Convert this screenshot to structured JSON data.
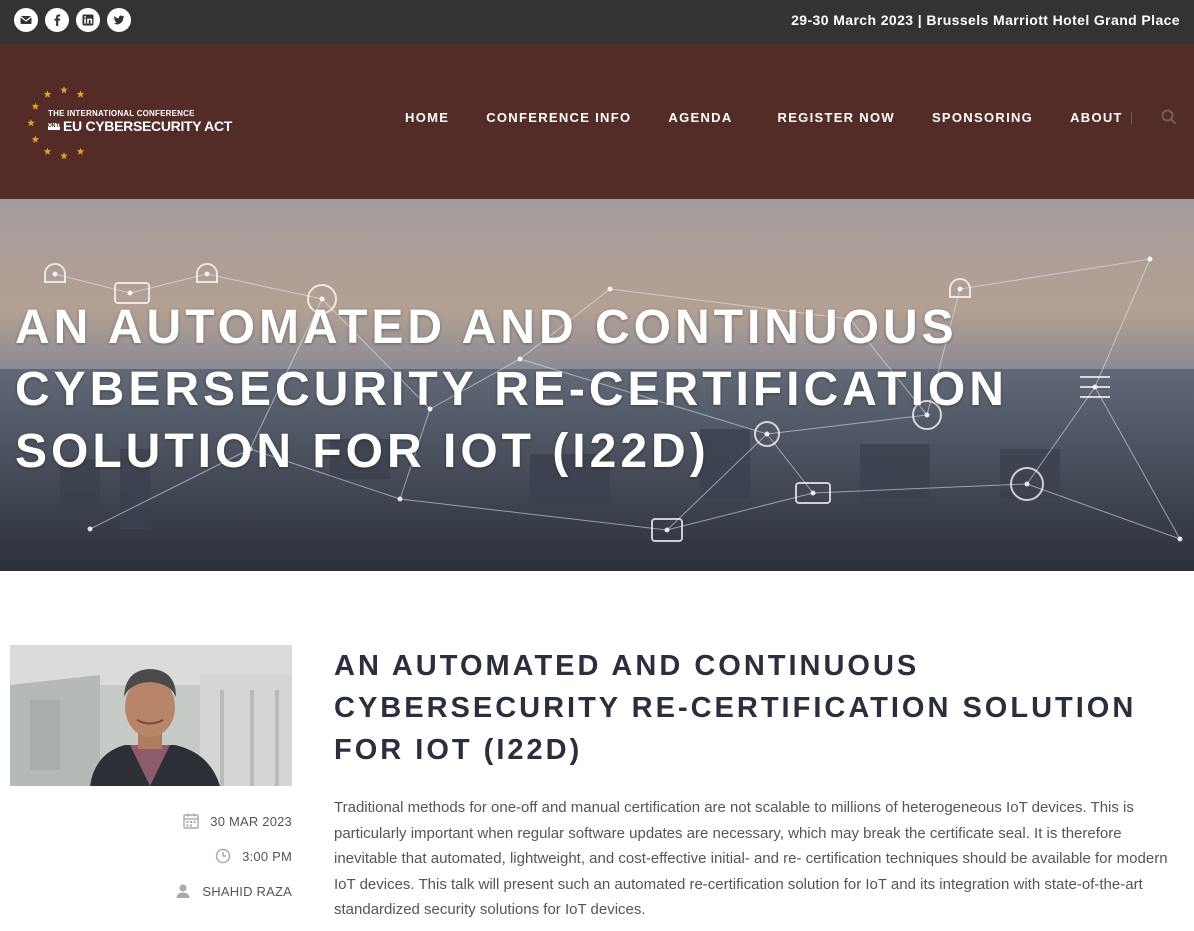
{
  "topbar": {
    "social": [
      {
        "name": "email-icon"
      },
      {
        "name": "facebook-icon"
      },
      {
        "name": "linkedin-icon"
      },
      {
        "name": "twitter-icon"
      }
    ],
    "event_info": "29-30 March 2023 | Brussels Marriott Hotel Grand Place"
  },
  "header": {
    "logo": {
      "line1": "THE INTERNATIONAL CONFERENCE",
      "small": "ON THE",
      "line2": "EU CYBERSECURITY ACT",
      "star_color": "#e2a12a"
    },
    "nav": [
      {
        "label": "HOME"
      },
      {
        "label": "CONFERENCE INFO"
      },
      {
        "label": "AGENDA"
      },
      {
        "label": "REGISTER NOW"
      },
      {
        "label": "SPONSORING"
      },
      {
        "label": "ABOUT"
      }
    ],
    "search_icon": "search-icon",
    "background": "#532b27"
  },
  "hero": {
    "title": "AN AUTOMATED AND CONTINUOUS CYBERSECURITY RE-CERTIFICATION SOLUTION FOR IOT (I22D)"
  },
  "session": {
    "title": "AN AUTOMATED AND CONTINUOUS CYBERSECURITY RE-CERTIFICATION SOLUTION FOR IOT (I22D)",
    "date": "30 MAR 2023",
    "time": "3:00 PM",
    "speaker": "SHAHID RAZA",
    "description": "Traditional methods for one-off and manual certification are not scalable to millions of heterogeneous IoT devices. This is particularly important when regular software updates are necessary, which may break the certificate seal. It is therefore inevitable that automated, lightweight, and cost-effective initial- and re- certification techniques should be available for modern IoT devices. This talk will present such an automated re-certification solution for IoT and its integration with state-of-the-art standardized security solutions for IoT devices."
  }
}
